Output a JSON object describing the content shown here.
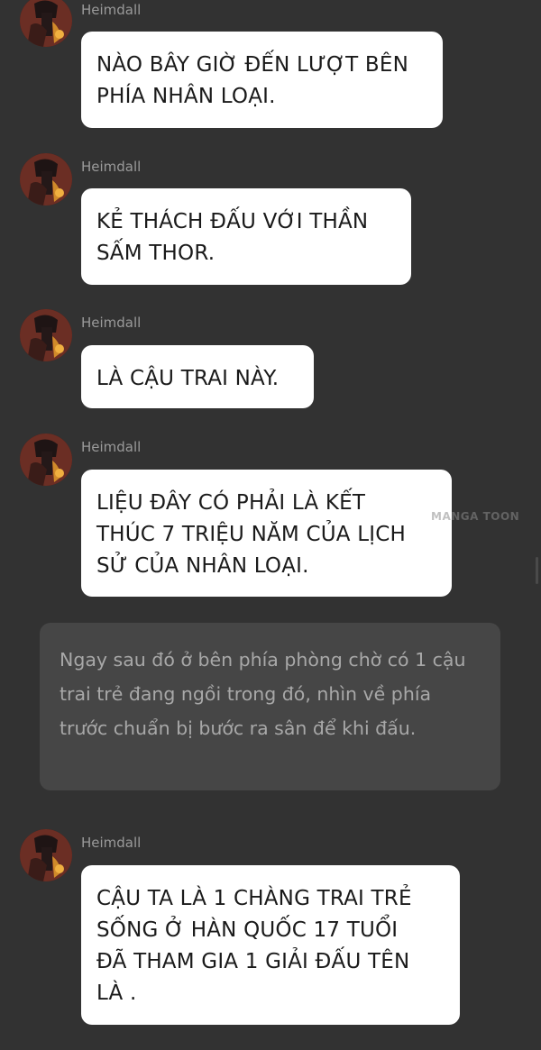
{
  "messages": [
    {
      "sender": "Heimdall",
      "text": "NÀO BÂY GIỜ ĐẾN LƯỢT BÊN\nPHÍA NHÂN LOẠI."
    },
    {
      "sender": "Heimdall",
      "text": "KẺ THÁCH ĐẤU VỚI THẦN\nSẤM THOR."
    },
    {
      "sender": "Heimdall",
      "text": "LÀ CẬU TRAI NÀY."
    },
    {
      "sender": "Heimdall",
      "text": "LIỆU ĐÂY CÓ PHẢI LÀ KẾT\nTHÚC 7 TRIỆU NĂM CỦA LỊCH\nSỬ CỦA NHÂN LOẠI."
    },
    {
      "sender": "Heimdall",
      "text": "CẬU TA LÀ 1 CHÀNG TRAI TRẺ\nSỐNG Ở HÀN QUỐC 17 TUỔI\nĐÃ THAM GIA 1 GIẢI ĐẤU TÊN\nLÀ ."
    }
  ],
  "narration": {
    "text": "Ngay sau đó ở bên phía phòng chờ có 1 cậu trai trẻ đang ngồi trong đó, nhìn về phía trước chuẩn bị bước ra sân để khi đấu."
  },
  "watermark": "MANGA TOON",
  "avatar_icon": "heimdall-avatar-icon",
  "colors": {
    "background": "#323232",
    "bubble": "#ffffff",
    "narration_box": "#464646",
    "narration_text": "#a8a8a8",
    "sender_text": "#9a9a9a"
  }
}
